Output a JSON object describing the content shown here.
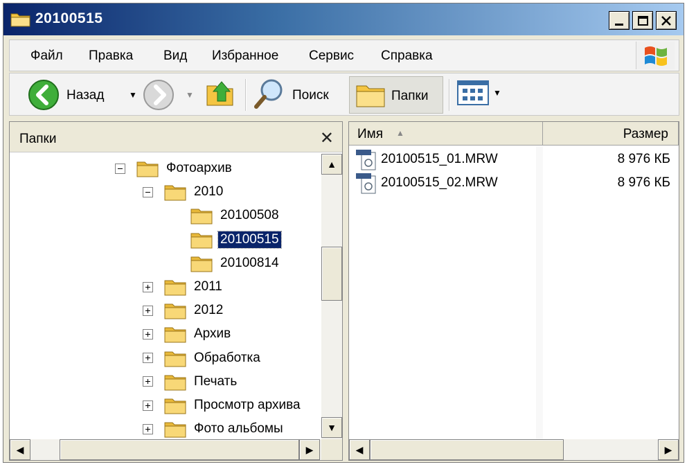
{
  "window": {
    "title": "20100515"
  },
  "menu": [
    "Файл",
    "Правка",
    "Вид",
    "Избранное",
    "Сервис",
    "Справка"
  ],
  "toolbar": {
    "back_label": "Назад",
    "search_label": "Поиск",
    "folders_label": "Папки"
  },
  "folders_panel": {
    "title": "Папки",
    "tree": [
      {
        "label": "Фотоархив",
        "expander": "minus",
        "level": 0
      },
      {
        "label": "2010",
        "expander": "minus",
        "level": 1
      },
      {
        "label": "20100508",
        "expander": "none",
        "level": 2
      },
      {
        "label": "20100515",
        "expander": "none",
        "level": 2,
        "selected": true
      },
      {
        "label": "20100814",
        "expander": "none",
        "level": 2
      },
      {
        "label": "2011",
        "expander": "plus",
        "level": 1
      },
      {
        "label": "2012",
        "expander": "plus",
        "level": 1
      },
      {
        "label": "Архив",
        "expander": "plus",
        "level": 1
      },
      {
        "label": "Обработка",
        "expander": "plus",
        "level": 1
      },
      {
        "label": "Печать",
        "expander": "plus",
        "level": 1
      },
      {
        "label": "Просмотр архива",
        "expander": "plus",
        "level": 1
      },
      {
        "label": "Фото альбомы",
        "expander": "plus",
        "level": 1
      }
    ]
  },
  "files_panel": {
    "columns": {
      "name": "Имя",
      "size": "Размер"
    },
    "files": [
      {
        "name": "20100515_01.MRW",
        "size": "8 976 КБ"
      },
      {
        "name": "20100515_02.MRW",
        "size": "8 976 КБ"
      }
    ]
  },
  "colors": {
    "title_bar": "#0a246a",
    "selection": "#0a246a",
    "folder": "#f4c542"
  }
}
